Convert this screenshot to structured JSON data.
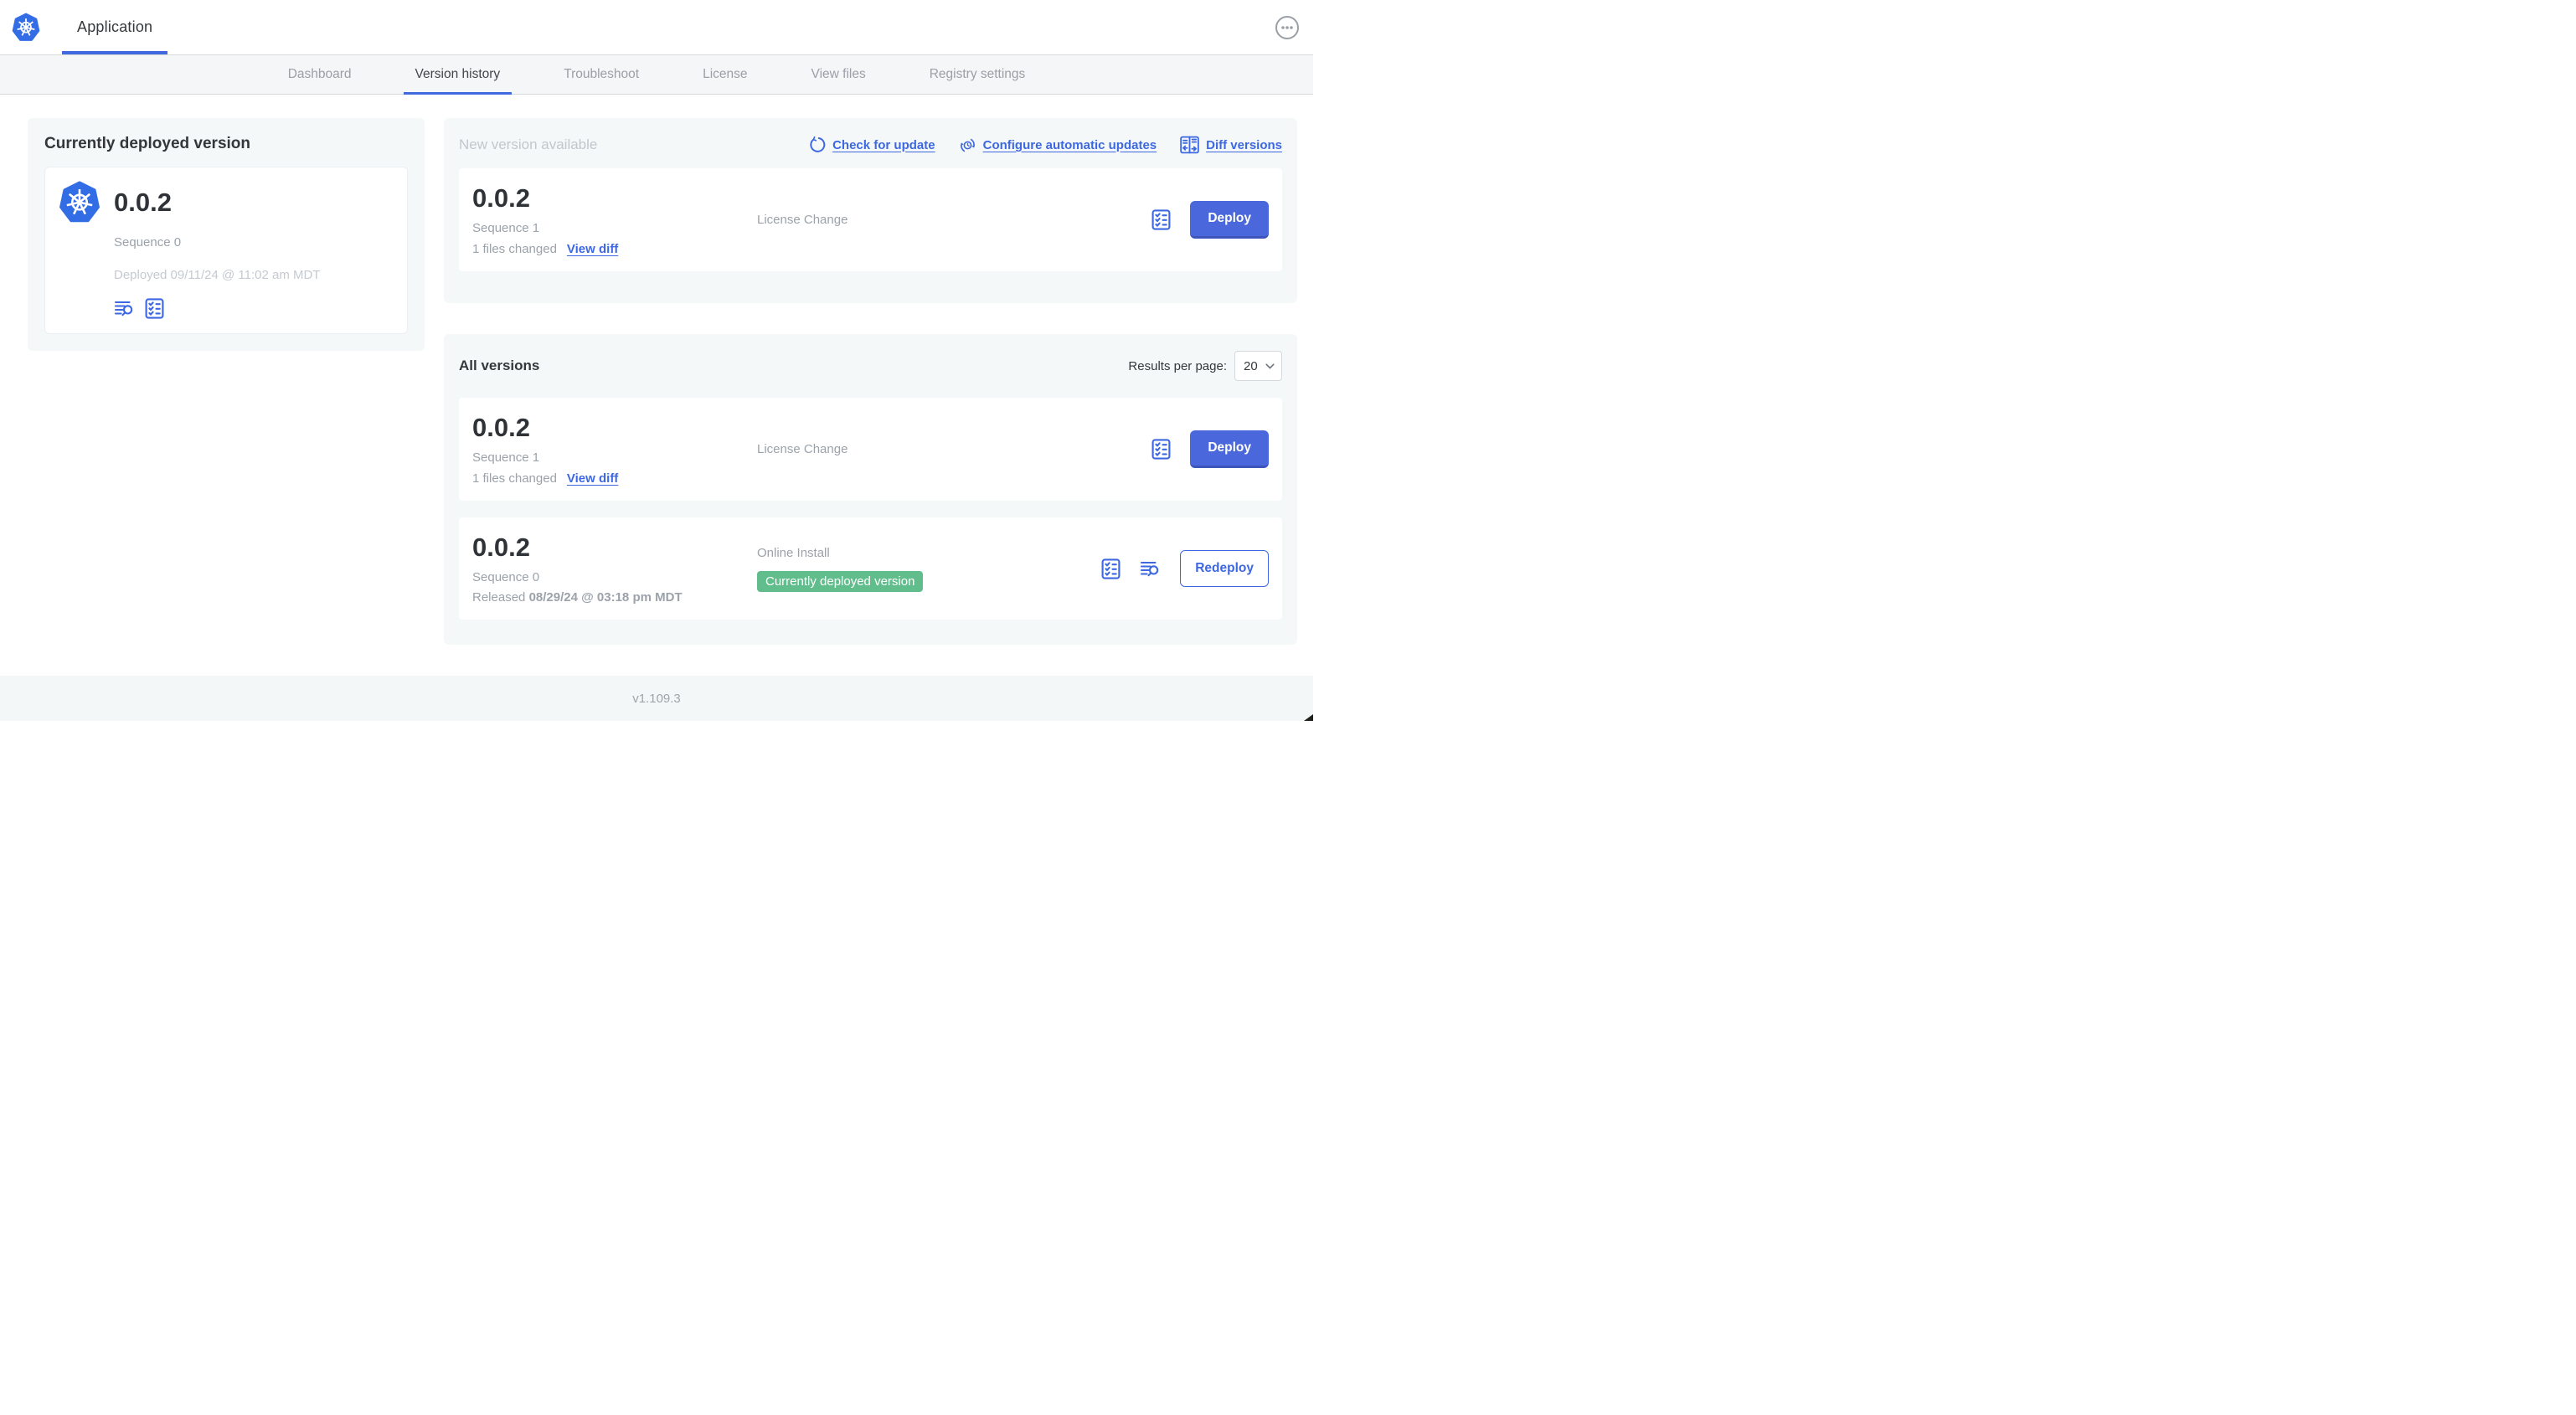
{
  "header": {
    "app_title": "Application"
  },
  "nav": {
    "tabs": [
      {
        "label": "Dashboard"
      },
      {
        "label": "Version history"
      },
      {
        "label": "Troubleshoot"
      },
      {
        "label": "License"
      },
      {
        "label": "View files"
      },
      {
        "label": "Registry settings"
      }
    ]
  },
  "deployed_panel": {
    "title": "Currently deployed version",
    "version": "0.0.2",
    "sequence": "Sequence 0",
    "deployed_at": "Deployed 09/11/24 @ 11:02 am MDT"
  },
  "new_version": {
    "title": "New version available",
    "check_for_update": "Check for update",
    "configure_updates": "Configure automatic updates",
    "diff_versions": "Diff versions",
    "row": {
      "version": "0.0.2",
      "sequence": "Sequence 1",
      "files_changed": "1 files changed",
      "view_diff": "View diff",
      "source": "License Change",
      "deploy_label": "Deploy"
    }
  },
  "all_versions": {
    "title": "All versions",
    "results_per_page_label": "Results per page:",
    "results_per_page_value": "20",
    "rows": [
      {
        "version": "0.0.2",
        "sequence": "Sequence 1",
        "files_changed": "1 files changed",
        "view_diff": "View diff",
        "source": "License Change",
        "action_label": "Deploy"
      },
      {
        "version": "0.0.2",
        "sequence": "Sequence 0",
        "released_prefix": "Released",
        "released_date": "08/29/24 @ 03:18 pm MDT",
        "source": "Online Install",
        "badge": "Currently deployed version",
        "action_label": "Redeploy"
      }
    ]
  },
  "footer": {
    "app_version": "v1.109.3"
  },
  "colors": {
    "accent_blue": "#4169DF",
    "link_blue": "#3D68E1",
    "button_blue": "#4A68DC",
    "logo_blue": "#326DE6",
    "badge_green": "#61BE8C",
    "panel_gray": "#F5F8F9"
  }
}
